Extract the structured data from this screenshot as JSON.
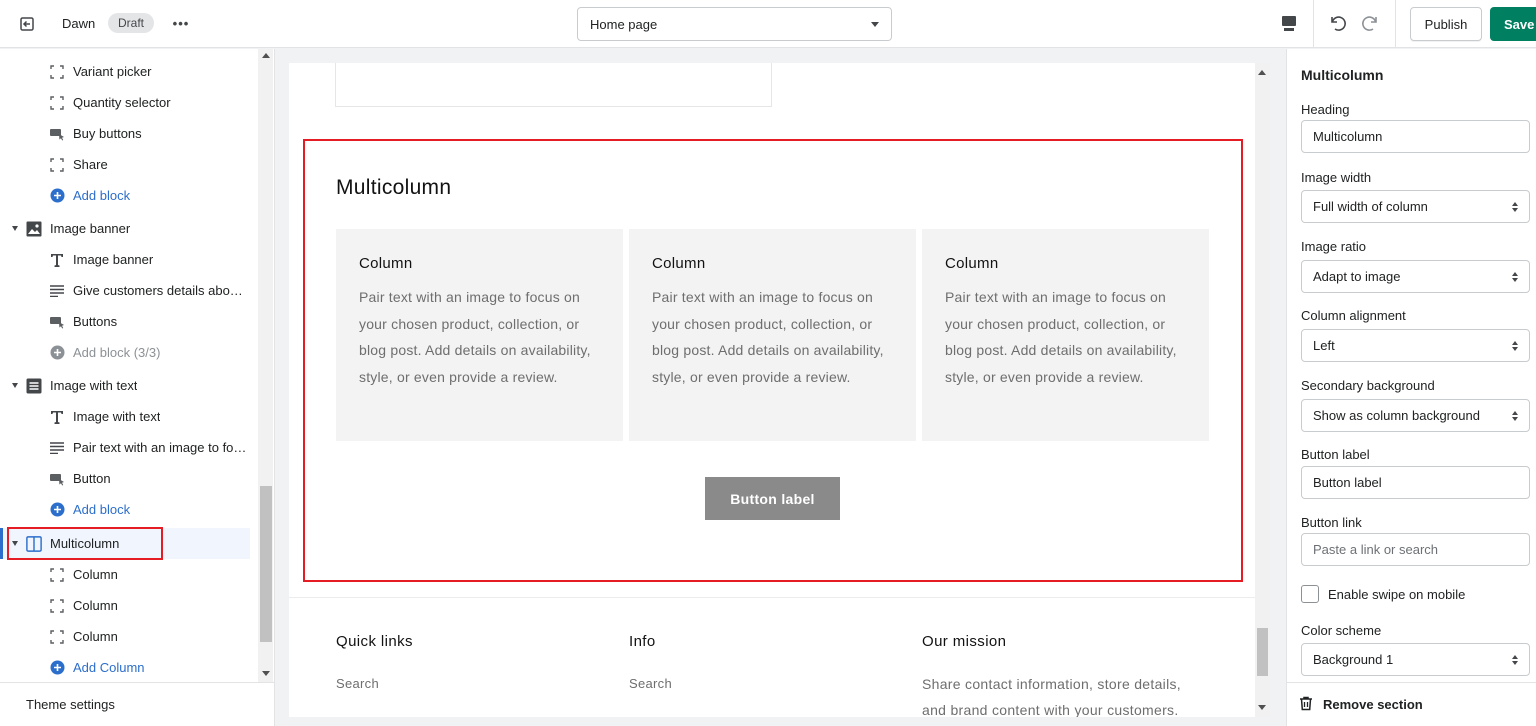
{
  "topbar": {
    "theme_name": "Dawn",
    "status_badge": "Draft",
    "more": "•••",
    "page_selector": "Home page",
    "publish_label": "Publish",
    "save_label": "Save"
  },
  "sidebar": {
    "items": [
      {
        "label": "Variant picker",
        "icon": "block-bracket-icon"
      },
      {
        "label": "Quantity selector",
        "icon": "block-bracket-icon"
      },
      {
        "label": "Buy buttons",
        "icon": "button-icon"
      },
      {
        "label": "Share",
        "icon": "block-bracket-icon"
      },
      {
        "label": "Add block",
        "icon": "plus-circle-icon"
      },
      {
        "label": "Image banner",
        "icon": "image-icon"
      },
      {
        "label": "Image banner",
        "icon": "text-icon"
      },
      {
        "label": "Give customers details about …",
        "icon": "paragraph-icon"
      },
      {
        "label": "Buttons",
        "icon": "button-icon"
      },
      {
        "label": "Add block (3/3)",
        "icon": "plus-circle-icon"
      },
      {
        "label": "Image with text",
        "icon": "image-text-icon"
      },
      {
        "label": "Image with text",
        "icon": "text-icon"
      },
      {
        "label": "Pair text with an image to foc...",
        "icon": "paragraph-icon"
      },
      {
        "label": "Button",
        "icon": "button-icon"
      },
      {
        "label": "Add block",
        "icon": "plus-circle-icon"
      },
      {
        "label": "Multicolumn",
        "icon": "columns-icon"
      },
      {
        "label": "Column",
        "icon": "block-bracket-icon"
      },
      {
        "label": "Column",
        "icon": "block-bracket-icon"
      },
      {
        "label": "Column",
        "icon": "block-bracket-icon"
      },
      {
        "label": "Add Column",
        "icon": "plus-circle-icon"
      }
    ],
    "theme_settings": "Theme settings"
  },
  "preview": {
    "multicolumn_title": "Multicolumn",
    "columns": [
      {
        "title": "Column",
        "body": "Pair text with an image to focus on your chosen product, collection, or blog post. Add details on availability, style, or even provide a review."
      },
      {
        "title": "Column",
        "body": "Pair text with an image to focus on your chosen product, collection, or blog post. Add details on availability, style, or even provide a review."
      },
      {
        "title": "Column",
        "body": "Pair text with an image to focus on your chosen product, collection, or blog post. Add details on availability, style, or even provide a review."
      }
    ],
    "button_label": "Button label",
    "footer": {
      "quick_links": "Quick links",
      "quick_links_item": "Search",
      "info": "Info",
      "info_item": "Search",
      "our_mission": "Our mission",
      "mission_text": "Share contact information, store details, and brand content with your customers."
    }
  },
  "settings": {
    "title": "Multicolumn",
    "heading_label": "Heading",
    "heading_value": "Multicolumn",
    "image_width_label": "Image width",
    "image_width_value": "Full width of column",
    "image_ratio_label": "Image ratio",
    "image_ratio_value": "Adapt to image",
    "column_alignment_label": "Column alignment",
    "column_alignment_value": "Left",
    "secondary_bg_label": "Secondary background",
    "secondary_bg_value": "Show as column background",
    "button_label_label": "Button label",
    "button_label_value": "Button label",
    "button_link_label": "Button link",
    "button_link_placeholder": "Paste a link or search",
    "swipe_label": "Enable swipe on mobile",
    "color_scheme_label": "Color scheme",
    "color_scheme_value": "Background 1",
    "remove_section": "Remove section"
  },
  "colors": {
    "accent": "#008060",
    "link": "#2c6ecb",
    "highlight": "#e51c23"
  }
}
